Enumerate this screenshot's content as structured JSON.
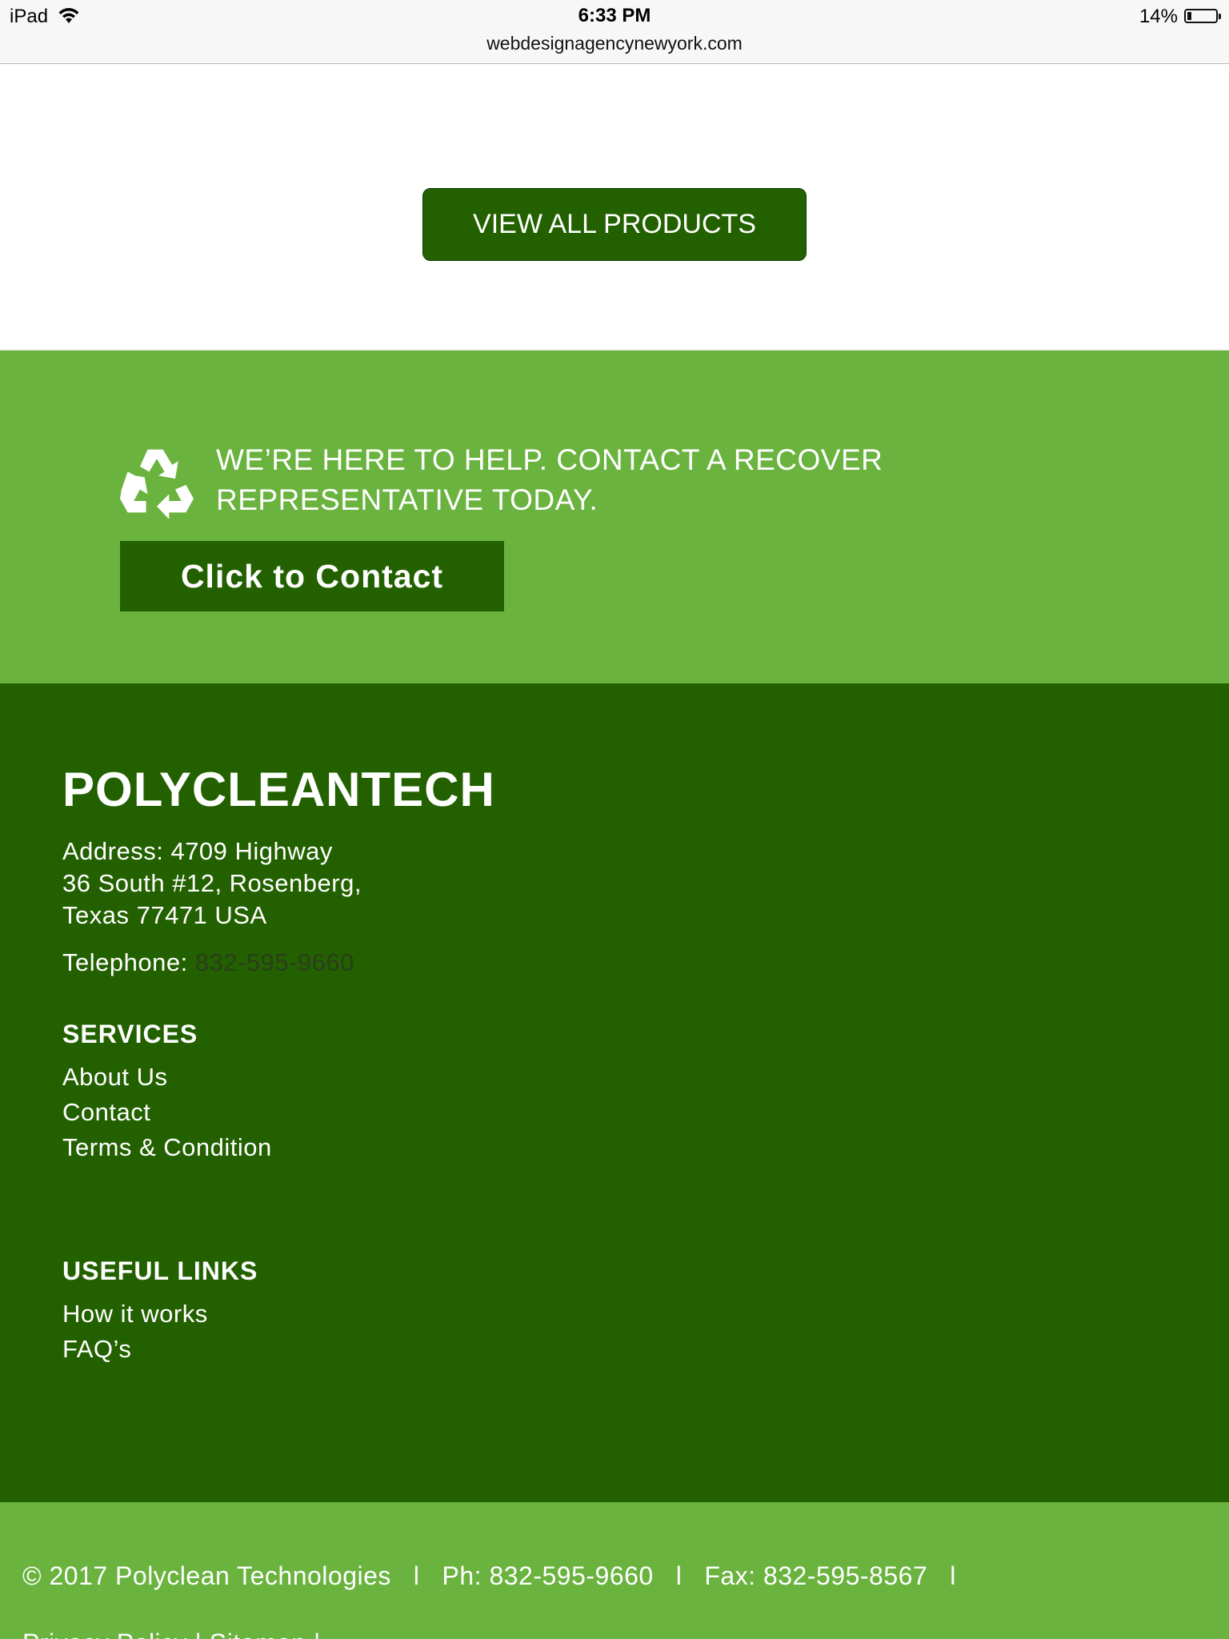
{
  "status_bar": {
    "device": "iPad",
    "time": "6:33 PM",
    "url": "webdesignagencynewyork.com",
    "battery": "14%",
    "battery_level": 0.14
  },
  "products": {
    "view_all_label": "VIEW ALL PRODUCTS"
  },
  "contact_band": {
    "icon": "recycle-icon",
    "heading_line1": "WE’RE HERE TO HELP. CONTACT A RECOVER",
    "heading_line2": "REPRESENTATIVE TODAY.",
    "button_label": "Click to Contact"
  },
  "footer": {
    "brand": "POLYCLEANTECH",
    "address_line1": "Address: 4709 Highway",
    "address_line2": "36 South #12, Rosenberg,",
    "address_line3": "Texas 77471 USA",
    "telephone_label": "Telephone: ",
    "telephone_number": "832-595-9660",
    "services_title": "SERVICES",
    "services_links": [
      "About Us",
      "Contact",
      "Terms & Condition"
    ],
    "useful_title": "USEFUL LINKS",
    "useful_links": [
      "How it works",
      "FAQ’s"
    ]
  },
  "bottom_bar": {
    "copyright": "© 2017 Polyclean Technologies",
    "phone": "Ph: 832-595-9660",
    "fax": "Fax: 832-595-8567",
    "separator": "l",
    "cut_off_text": "Privacy Policy  |  Sitemap  |"
  },
  "colors": {
    "dark_green": "#236100",
    "light_green": "#6ab33e",
    "white": "#ffffff"
  }
}
